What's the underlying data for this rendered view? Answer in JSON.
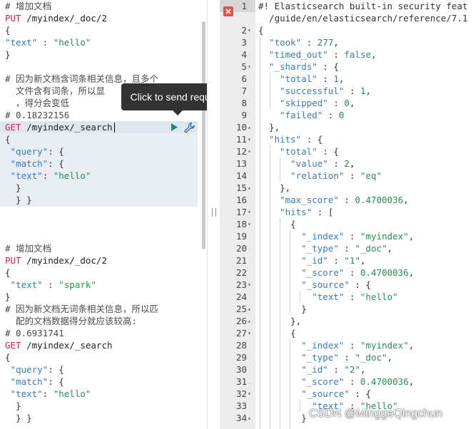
{
  "console": {
    "lines": [
      {
        "cls": "c-comment",
        "text": "# 增加文档"
      },
      {
        "cls": "c-method",
        "text": "PUT",
        "rest": " /myindex/_doc/2"
      },
      {
        "cls": "c-brace",
        "text": "{"
      },
      {
        "cls": "mix",
        "key": "\"text\"",
        "sep": " : ",
        "val": "\"hello\"",
        "suffix": ""
      },
      {
        "cls": "c-brace",
        "text": "}"
      },
      {
        "cls": "blank",
        "text": ""
      },
      {
        "cls": "c-comment",
        "text": "# 因为新文档含词条相关信息，且多个"
      },
      {
        "cls": "c-comment",
        "text": "  文件含有词条，所以显"
      },
      {
        "cls": "c-comment",
        "text": "  ，得分会变低"
      },
      {
        "cls": "c-comment",
        "text": "# 0.18232156"
      },
      {
        "cls": "c-method",
        "text": "GET",
        "rest": " /myindex/_search"
      },
      {
        "cls": "c-brace",
        "text": "{"
      },
      {
        "cls": "mix",
        "key": " \"query\"",
        "sep": ": ",
        "val": "{",
        "suffix": ""
      },
      {
        "cls": "mix",
        "key": " \"match\"",
        "sep": ":",
        "val": " {",
        "suffix": ""
      },
      {
        "cls": "mix",
        "key": " \"text\"",
        "sep": ": ",
        "val": "\"hello\"",
        "suffix": ""
      },
      {
        "cls": "c-brace",
        "text": "  }"
      },
      {
        "cls": "c-brace",
        "text": "  } }"
      },
      {
        "cls": "blank",
        "text": ""
      },
      {
        "cls": "blank",
        "text": ""
      },
      {
        "cls": "blank",
        "text": ""
      },
      {
        "cls": "c-comment",
        "text": "# 增加文档"
      },
      {
        "cls": "c-method",
        "text": "PUT",
        "rest": " /myindex/_doc/2"
      },
      {
        "cls": "c-brace",
        "text": "{"
      },
      {
        "cls": "mix",
        "key": " \"text\"",
        "sep": " : ",
        "val": "\"spark\"",
        "suffix": ""
      },
      {
        "cls": "c-brace",
        "text": "}"
      },
      {
        "cls": "c-comment",
        "text": "# 因为新文档无词条相关信息，所以匹"
      },
      {
        "cls": "c-comment",
        "text": "  配的文档数据得分就应该较高:"
      },
      {
        "cls": "c-comment",
        "text": "# 0.6931741"
      },
      {
        "cls": "c-method",
        "text": "GET",
        "rest": " /myindex/_search"
      },
      {
        "cls": "c-brace",
        "text": "{"
      },
      {
        "cls": "mix",
        "key": " \"query\"",
        "sep": ": ",
        "val": "{",
        "suffix": ""
      },
      {
        "cls": "mix",
        "key": " \"match\"",
        "sep": ": ",
        "val": "{",
        "suffix": ""
      },
      {
        "cls": "mix",
        "key": " \"text\"",
        "sep": ": ",
        "val": "\"hello\"",
        "suffix": ""
      },
      {
        "cls": "c-brace",
        "text": "  }"
      },
      {
        "cls": "c-brace",
        "text": "  } }"
      }
    ],
    "tooltip": "Click to send request",
    "play_icon": "play-icon",
    "wrench_icon": "wrench-icon"
  },
  "response": {
    "lines": [
      {
        "n": "1",
        "fold": "",
        "t": [
          [
            "r-punc",
            "#! Elasticsearch built-in security feat"
          ]
        ]
      },
      {
        "n": "",
        "fold": "",
        "t": [
          [
            "r-punc",
            "  /guide/en/elasticsearch/reference/7.1"
          ]
        ]
      },
      {
        "n": "2",
        "fold": "▾",
        "t": [
          [
            "r-punc",
            "{"
          ]
        ]
      },
      {
        "n": "3",
        "fold": "",
        "t": [
          [
            "r-key",
            "  \"took\""
          ],
          [
            "r-punc",
            " : "
          ],
          [
            "r-num",
            "277"
          ],
          [
            "r-punc",
            ","
          ]
        ]
      },
      {
        "n": "4",
        "fold": "",
        "t": [
          [
            "r-key",
            "  \"timed_out\""
          ],
          [
            "r-punc",
            " : "
          ],
          [
            "r-bool",
            "false"
          ],
          [
            "r-punc",
            ","
          ]
        ]
      },
      {
        "n": "5",
        "fold": "▾",
        "t": [
          [
            "r-key",
            "  \"_shards\""
          ],
          [
            "r-punc",
            " : {"
          ]
        ]
      },
      {
        "n": "6",
        "fold": "",
        "t": [
          [
            "r-key",
            "    \"total\""
          ],
          [
            "r-punc",
            " : "
          ],
          [
            "r-num",
            "1"
          ],
          [
            "r-punc",
            ","
          ]
        ]
      },
      {
        "n": "7",
        "fold": "",
        "t": [
          [
            "r-key",
            "    \"successful\""
          ],
          [
            "r-punc",
            " : "
          ],
          [
            "r-num",
            "1"
          ],
          [
            "r-punc",
            ","
          ]
        ]
      },
      {
        "n": "8",
        "fold": "",
        "t": [
          [
            "r-key",
            "    \"skipped\""
          ],
          [
            "r-punc",
            " : "
          ],
          [
            "r-num",
            "0"
          ],
          [
            "r-punc",
            ","
          ]
        ]
      },
      {
        "n": "9",
        "fold": "",
        "t": [
          [
            "r-key",
            "    \"failed\""
          ],
          [
            "r-punc",
            " : "
          ],
          [
            "r-num",
            "0"
          ]
        ]
      },
      {
        "n": "10",
        "fold": "▴",
        "t": [
          [
            "r-punc",
            "  },"
          ]
        ]
      },
      {
        "n": "11",
        "fold": "▾",
        "t": [
          [
            "r-key",
            "  \"hits\""
          ],
          [
            "r-punc",
            " : {"
          ]
        ]
      },
      {
        "n": "12",
        "fold": "▾",
        "t": [
          [
            "r-key",
            "    \"total\""
          ],
          [
            "r-punc",
            " : {"
          ]
        ]
      },
      {
        "n": "13",
        "fold": "",
        "t": [
          [
            "r-key",
            "      \"value\""
          ],
          [
            "r-punc",
            " : "
          ],
          [
            "r-num",
            "2"
          ],
          [
            "r-punc",
            ","
          ]
        ]
      },
      {
        "n": "14",
        "fold": "",
        "t": [
          [
            "r-key",
            "      \"relation\""
          ],
          [
            "r-punc",
            " : "
          ],
          [
            "r-str",
            "\"eq\""
          ]
        ]
      },
      {
        "n": "15",
        "fold": "▴",
        "t": [
          [
            "r-punc",
            "    },"
          ]
        ]
      },
      {
        "n": "16",
        "fold": "",
        "t": [
          [
            "r-key",
            "    \"max_score\""
          ],
          [
            "r-punc",
            " : "
          ],
          [
            "r-num",
            "0.4700036"
          ],
          [
            "r-punc",
            ","
          ]
        ]
      },
      {
        "n": "17",
        "fold": "▾",
        "t": [
          [
            "r-key",
            "    \"hits\""
          ],
          [
            "r-punc",
            " : ["
          ]
        ]
      },
      {
        "n": "18",
        "fold": "▾",
        "t": [
          [
            "r-punc",
            "      {"
          ]
        ]
      },
      {
        "n": "19",
        "fold": "",
        "t": [
          [
            "r-key",
            "        \"_index\""
          ],
          [
            "r-punc",
            " : "
          ],
          [
            "r-str",
            "\"myindex\""
          ],
          [
            "r-punc",
            ","
          ]
        ]
      },
      {
        "n": "20",
        "fold": "",
        "t": [
          [
            "r-key",
            "        \"_type\""
          ],
          [
            "r-punc",
            " : "
          ],
          [
            "r-str",
            "\"_doc\""
          ],
          [
            "r-punc",
            ","
          ]
        ]
      },
      {
        "n": "21",
        "fold": "",
        "t": [
          [
            "r-key",
            "        \"_id\""
          ],
          [
            "r-punc",
            " : "
          ],
          [
            "r-str",
            "\"1\""
          ],
          [
            "r-punc",
            ","
          ]
        ]
      },
      {
        "n": "22",
        "fold": "",
        "t": [
          [
            "r-key",
            "        \"_score\""
          ],
          [
            "r-punc",
            " : "
          ],
          [
            "r-num",
            "0.4700036"
          ],
          [
            "r-punc",
            ","
          ]
        ]
      },
      {
        "n": "23",
        "fold": "▾",
        "t": [
          [
            "r-key",
            "        \"_source\""
          ],
          [
            "r-punc",
            " : {"
          ]
        ]
      },
      {
        "n": "24",
        "fold": "",
        "t": [
          [
            "r-key",
            "          \"text\""
          ],
          [
            "r-punc",
            " : "
          ],
          [
            "r-str",
            "\"hello\""
          ]
        ]
      },
      {
        "n": "25",
        "fold": "▴",
        "t": [
          [
            "r-punc",
            "        }"
          ]
        ]
      },
      {
        "n": "26",
        "fold": "▴",
        "t": [
          [
            "r-punc",
            "      },"
          ]
        ]
      },
      {
        "n": "27",
        "fold": "▾",
        "t": [
          [
            "r-punc",
            "      {"
          ]
        ]
      },
      {
        "n": "28",
        "fold": "",
        "t": [
          [
            "r-key",
            "        \"_index\""
          ],
          [
            "r-punc",
            " : "
          ],
          [
            "r-str",
            "\"myindex\""
          ],
          [
            "r-punc",
            ","
          ]
        ]
      },
      {
        "n": "29",
        "fold": "",
        "t": [
          [
            "r-key",
            "        \"_type\""
          ],
          [
            "r-punc",
            " : "
          ],
          [
            "r-str",
            "\"_doc\""
          ],
          [
            "r-punc",
            ","
          ]
        ]
      },
      {
        "n": "30",
        "fold": "",
        "t": [
          [
            "r-key",
            "        \"_id\""
          ],
          [
            "r-punc",
            " : "
          ],
          [
            "r-str",
            "\"2\""
          ],
          [
            "r-punc",
            ","
          ]
        ]
      },
      {
        "n": "31",
        "fold": "",
        "t": [
          [
            "r-key",
            "        \"_score\""
          ],
          [
            "r-punc",
            " : "
          ],
          [
            "r-num",
            "0.4700036"
          ],
          [
            "r-punc",
            ","
          ]
        ]
      },
      {
        "n": "32",
        "fold": "▾",
        "t": [
          [
            "r-key",
            "        \"_source\""
          ],
          [
            "r-punc",
            " : {"
          ]
        ]
      },
      {
        "n": "33",
        "fold": "",
        "t": [
          [
            "r-key",
            "          \"text\""
          ],
          [
            "r-punc",
            " : "
          ],
          [
            "r-str",
            "\"hello\""
          ]
        ]
      },
      {
        "n": "34",
        "fold": "▴",
        "t": [
          [
            "r-punc",
            "        }"
          ]
        ]
      }
    ]
  },
  "error_icon": "close-icon",
  "watermark": "CSDN @MinggeQingchun"
}
